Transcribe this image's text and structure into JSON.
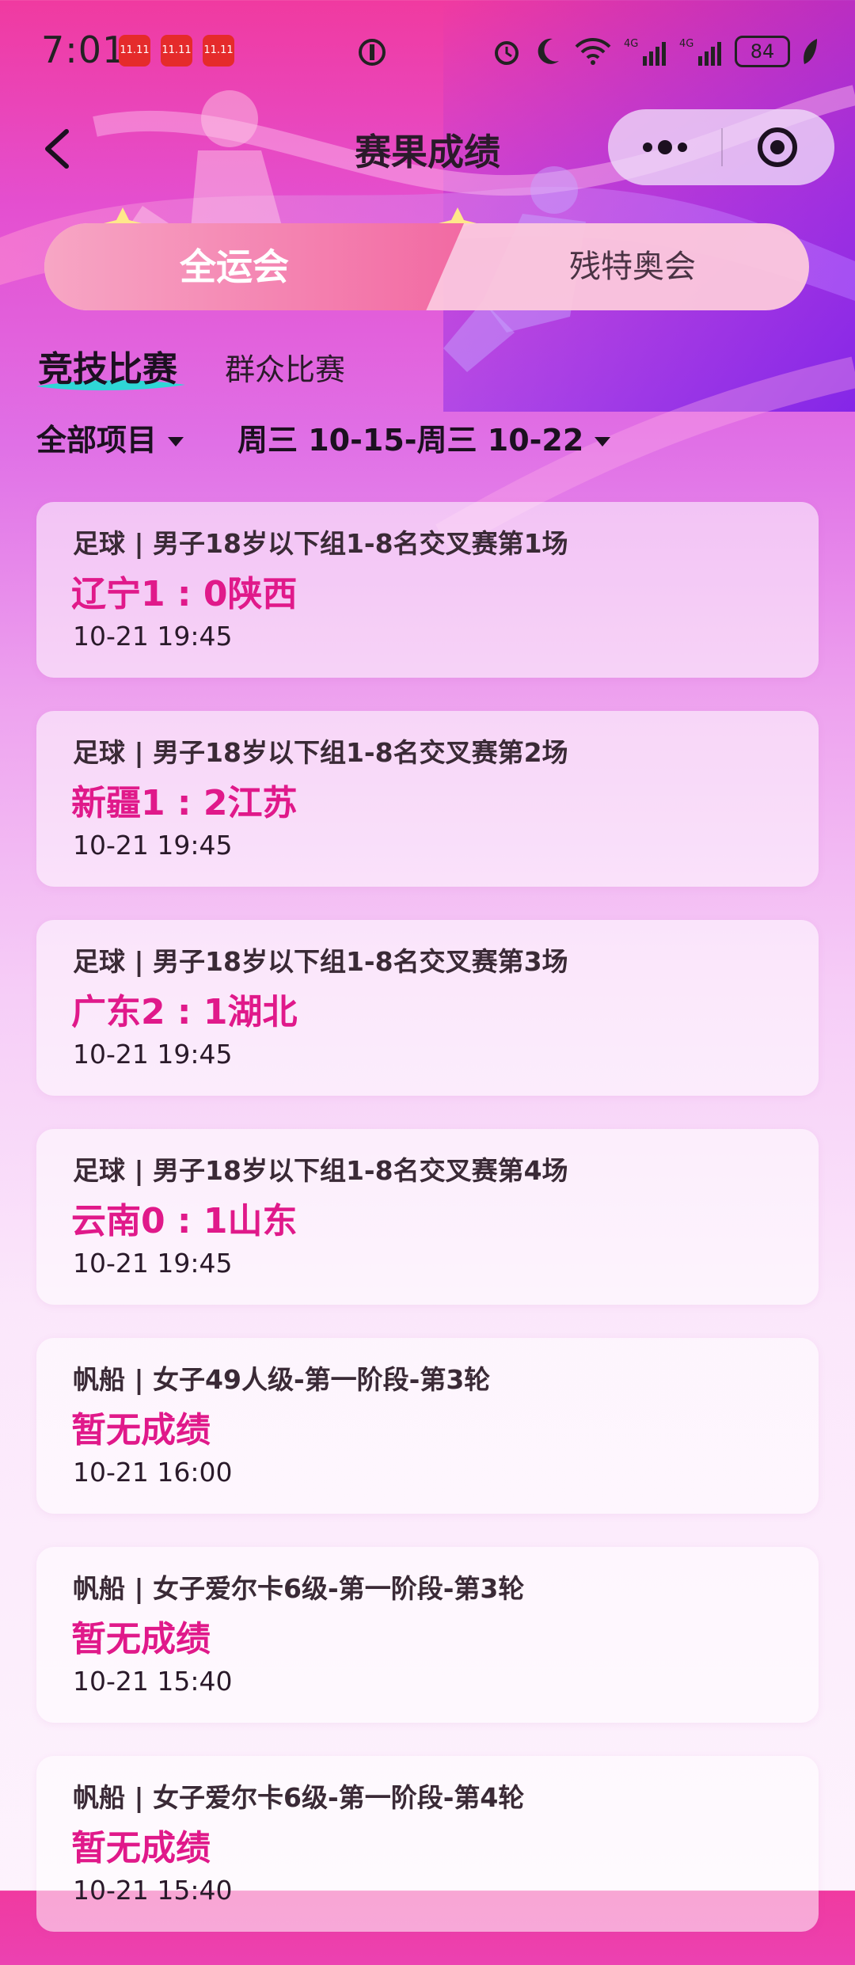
{
  "status_bar": {
    "time": "7:01",
    "notifications": [
      "11.11",
      "11.11",
      "11.11"
    ],
    "battery": "84",
    "network_labels": [
      "4G",
      "4G"
    ],
    "icons": [
      "alarm-icon",
      "moon-icon",
      "wifi-icon",
      "signal-icon",
      "signal-icon",
      "battery-icon",
      "leaf-icon"
    ]
  },
  "header": {
    "title": "赛果成绩",
    "back_icon": "chevron-left-icon",
    "more_icon": "more-dots-icon",
    "close_icon": "target-circle-icon"
  },
  "segment": {
    "active_label": "全运会",
    "inactive_label": "残特奥会"
  },
  "sub_tabs": {
    "active": "竞技比赛",
    "inactive": "群众比赛"
  },
  "filters": {
    "event": "全部项目",
    "date_range": "周三 10-15-周三 10-22"
  },
  "results": [
    {
      "title": "足球 | 男子18岁以下组1-8名交叉赛第1场",
      "score": "辽宁1 : 0陕西",
      "time": "10-21 19:45"
    },
    {
      "title": "足球 | 男子18岁以下组1-8名交叉赛第2场",
      "score": "新疆1 : 2江苏",
      "time": "10-21 19:45"
    },
    {
      "title": "足球 | 男子18岁以下组1-8名交叉赛第3场",
      "score": "广东2 : 1湖北",
      "time": "10-21 19:45"
    },
    {
      "title": "足球 | 男子18岁以下组1-8名交叉赛第4场",
      "score": "云南0 : 1山东",
      "time": "10-21 19:45"
    },
    {
      "title": "帆船 | 女子49人级-第一阶段-第3轮",
      "score": "暂无成绩",
      "time": "10-21 16:00"
    },
    {
      "title": "帆船 | 女子爱尔卡6级-第一阶段-第3轮",
      "score": "暂无成绩",
      "time": "10-21 15:40"
    },
    {
      "title": "帆船 | 女子爱尔卡6级-第一阶段-第4轮",
      "score": "暂无成绩",
      "time": "10-21 15:40"
    }
  ],
  "colors": {
    "score": "#e0198a",
    "accent_underline": "#2fd6d6",
    "segment_active": "#f26aa3"
  }
}
